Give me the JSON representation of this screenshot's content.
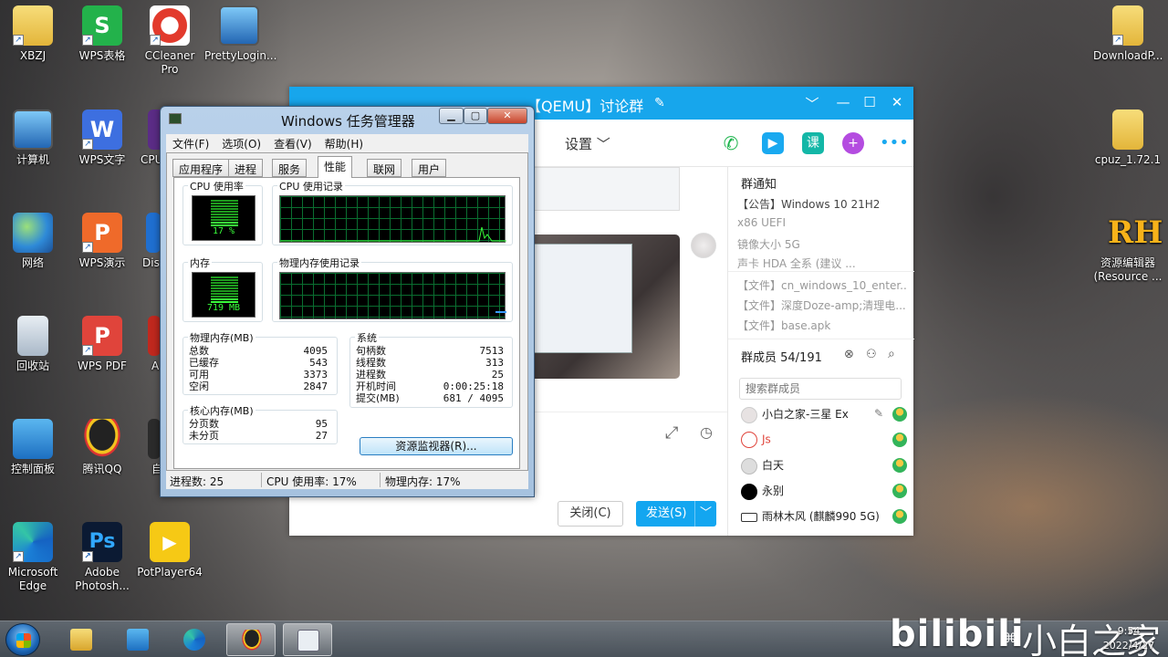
{
  "desktop": {
    "icons": [
      {
        "label": "XBZJ",
        "icon": "folder-user-icon"
      },
      {
        "label": "WPS表格",
        "icon": "wps-sheet-icon",
        "glyph": "S"
      },
      {
        "label": "CCleaner Pro",
        "icon": "ccleaner-icon"
      },
      {
        "label": "PrettyLogin...",
        "icon": "monitor-icon"
      },
      {
        "label": "计算机",
        "icon": "computer-icon"
      },
      {
        "label": "WPS文字",
        "icon": "wps-writer-icon",
        "glyph": "W"
      },
      {
        "label": "CPU",
        "icon": "cpu-icon"
      },
      {
        "label": "网络",
        "icon": "network-icon"
      },
      {
        "label": "WPS演示",
        "icon": "wps-present-icon",
        "glyph": "P"
      },
      {
        "label": "Dis",
        "icon": "display-icon"
      },
      {
        "label": "回收站",
        "icon": "recycle-bin-icon"
      },
      {
        "label": "WPS PDF",
        "icon": "wps-pdf-icon",
        "glyph": "P"
      },
      {
        "label": "A",
        "icon": "app-icon"
      },
      {
        "label": "控制面板",
        "icon": "control-panel-icon"
      },
      {
        "label": "腾讯QQ",
        "icon": "qq-icon"
      },
      {
        "label": "自",
        "icon": "app2-icon"
      },
      {
        "label": "Microsoft Edge",
        "icon": "edge-icon"
      },
      {
        "label": "Adobe Photosh...",
        "icon": "photoshop-icon",
        "glyph": "Ps"
      },
      {
        "label": "PotPlayer64",
        "icon": "potplayer-icon"
      },
      {
        "label": "DownloadP...",
        "icon": "folder-icon"
      },
      {
        "label": "cpuz_1.72.1",
        "icon": "folder-icon"
      },
      {
        "label": "资源编辑器 (Resource ...",
        "icon": "resource-hacker-icon",
        "glyph": "RH"
      }
    ]
  },
  "qq_window": {
    "title": "【QEMU】讨论群",
    "settings_label": "设置",
    "close_button": "关闭(C)",
    "send_button": "发送(S)",
    "notice_title": "群通知",
    "notice_lines": [
      "【公告】Windows 10 21H2",
      "x86 UEFI",
      "镜像大小 5G",
      "声卡 HDA 全系 (建议 ...",
      "【文件】cn_windows_10_enter...",
      "【文件】深度Doze-amp;清理电...",
      "【文件】base.apk"
    ],
    "members_title": "群成员 54/191",
    "member_search_placeholder": "搜索群成员",
    "members": [
      {
        "name": "小白之家-三星 Ex",
        "color": "#222222"
      },
      {
        "name": "Js",
        "color": "#e0443b"
      },
      {
        "name": "白天",
        "color": "#222222"
      },
      {
        "name": "永别",
        "color": "#222222"
      },
      {
        "name": "雨林木风 (麒麟990 5G)",
        "color": "#222222"
      }
    ]
  },
  "task_manager": {
    "title": "Windows 任务管理器",
    "menu": [
      "文件(F)",
      "选项(O)",
      "查看(V)",
      "帮助(H)"
    ],
    "tabs": [
      "应用程序",
      "进程",
      "服务",
      "性能",
      "联网",
      "用户"
    ],
    "active_tab": "性能",
    "cpu_usage_label": "CPU 使用率",
    "cpu_usage_value": "17 %",
    "cpu_usage_fraction": 0.17,
    "cpu_history_label": "CPU 使用记录",
    "memory_label": "内存",
    "memory_value": "719 MB",
    "memory_fraction": 0.17,
    "memory_history_label": "物理内存使用记录",
    "physical_memory": {
      "title": "物理内存(MB)",
      "rows": [
        {
          "k": "总数",
          "v": "4095"
        },
        {
          "k": "已缓存",
          "v": "543"
        },
        {
          "k": "可用",
          "v": "3373"
        },
        {
          "k": "空闲",
          "v": "2847"
        }
      ]
    },
    "kernel_memory": {
      "title": "核心内存(MB)",
      "rows": [
        {
          "k": "分页数",
          "v": "95"
        },
        {
          "k": "未分页",
          "v": "27"
        }
      ]
    },
    "system": {
      "title": "系统",
      "rows": [
        {
          "k": "句柄数",
          "v": "7513"
        },
        {
          "k": "线程数",
          "v": "313"
        },
        {
          "k": "进程数",
          "v": "25"
        },
        {
          "k": "开机时间",
          "v": "0:00:25:18"
        },
        {
          "k": "提交(MB)",
          "v": "681 / 4095"
        }
      ]
    },
    "resource_monitor_button": "资源监视器(R)...",
    "status": {
      "processes": "进程数: 25",
      "cpu": "CPU 使用率: 17%",
      "memory": "物理内存: 17%"
    }
  },
  "taskbar": {
    "watermark_latin": "bilibili",
    "watermark_cn": "小白之家",
    "time": "9:54",
    "date": "2022/4/27"
  },
  "colors": {
    "qq_blue": "#17a6ec",
    "gauge_green": "#39ff3a"
  }
}
